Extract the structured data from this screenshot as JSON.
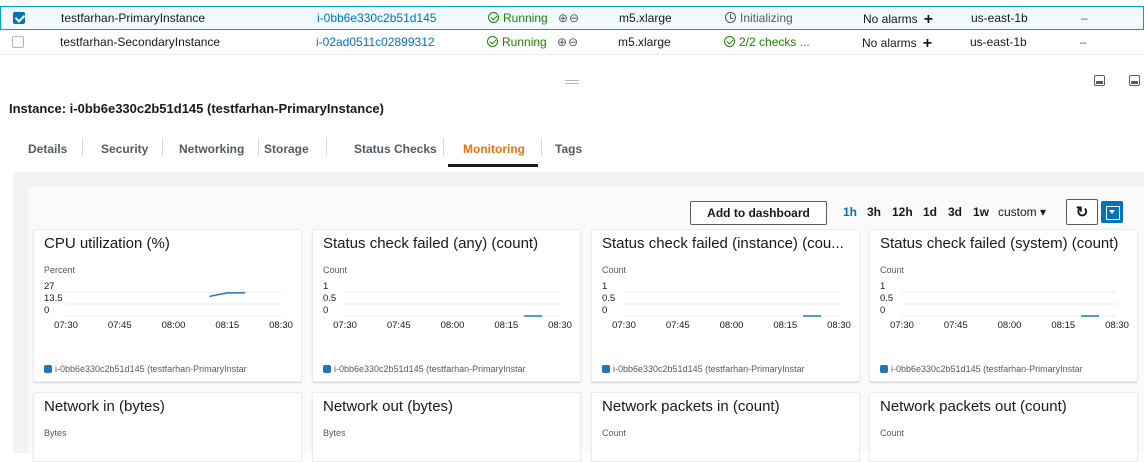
{
  "instances": [
    {
      "selected": true,
      "name": "testfarhan-PrimaryInstance",
      "id": "i-0bb6e330c2b51d145",
      "state": "Running",
      "type": "m5.xlarge",
      "status_check": "Initializing",
      "status_icon": "clock-icon",
      "alarms": "No alarms",
      "zone": "us-east-1b",
      "extra": "–"
    },
    {
      "selected": false,
      "name": "testfarhan-SecondaryInstance",
      "id": "i-02ad0511c02899312",
      "state": "Running",
      "type": "m5.xlarge",
      "status_check": "2/2 checks ...",
      "status_icon": "check-circle-icon",
      "alarms": "No alarms",
      "zone": "us-east-1b",
      "extra": "–"
    }
  ],
  "details": {
    "title": "Instance: i-0bb6e330c2b51d145 (testfarhan-PrimaryInstance)",
    "tabs": [
      "Details",
      "Security",
      "Networking",
      "Storage",
      "Status Checks",
      "Monitoring",
      "Tags"
    ],
    "active_tab": "Monitoring"
  },
  "toolbar": {
    "add_to_dashboard": "Add to dashboard",
    "ranges": [
      "1h",
      "3h",
      "12h",
      "1d",
      "3d",
      "1w"
    ],
    "active_range": "1h",
    "custom": "custom ▾",
    "refresh_icon": "refresh-icon"
  },
  "colors": {
    "accent": "#ec7211",
    "link": "#0073bb",
    "ok": "#1d8102",
    "series": "#1f77b4"
  },
  "chart_data": [
    {
      "type": "line",
      "title": "CPU utilization (%)",
      "ylabel": "Percent",
      "yticks": [
        "27",
        "13.5",
        "0"
      ],
      "ylim": [
        0,
        27
      ],
      "xticks": [
        "07:30",
        "07:45",
        "08:00",
        "08:15",
        "08:30"
      ],
      "x": [
        "08:10",
        "08:15",
        "08:20"
      ],
      "series": [
        {
          "name": "i-0bb6e330c2b51d145 (testfarhan-PrimaryInstar",
          "values": [
            22,
            26,
            26
          ]
        }
      ]
    },
    {
      "type": "line",
      "title": "Status check failed (any) (count)",
      "ylabel": "Count",
      "yticks": [
        "1",
        "0.5",
        "0"
      ],
      "ylim": [
        0,
        1
      ],
      "xticks": [
        "07:30",
        "07:45",
        "08:00",
        "08:15",
        "08:30"
      ],
      "x": [
        "08:20",
        "08:25"
      ],
      "series": [
        {
          "name": "i-0bb6e330c2b51d145 (testfarhan-PrimaryInstar",
          "values": [
            0,
            0
          ]
        }
      ]
    },
    {
      "type": "line",
      "title": "Status check failed (instance) (cou...",
      "ylabel": "Count",
      "yticks": [
        "1",
        "0.5",
        "0"
      ],
      "ylim": [
        0,
        1
      ],
      "xticks": [
        "07:30",
        "07:45",
        "08:00",
        "08:15",
        "08:30"
      ],
      "x": [
        "08:20",
        "08:25"
      ],
      "series": [
        {
          "name": "i-0bb6e330c2b51d145 (testfarhan-PrimaryInstar",
          "values": [
            0,
            0
          ]
        }
      ]
    },
    {
      "type": "line",
      "title": "Status check failed (system) (count)",
      "ylabel": "Count",
      "yticks": [
        "1",
        "0.5",
        "0"
      ],
      "ylim": [
        0,
        1
      ],
      "xticks": [
        "07:30",
        "07:45",
        "08:00",
        "08:15",
        "08:30"
      ],
      "x": [
        "08:20",
        "08:25"
      ],
      "series": [
        {
          "name": "i-0bb6e330c2b51d145 (testfarhan-PrimaryInstar",
          "values": [
            0,
            0
          ]
        }
      ]
    },
    {
      "type": "line",
      "title": "Network in (bytes)",
      "ylabel": "Bytes",
      "yticks": [],
      "xticks": [],
      "series": []
    },
    {
      "type": "line",
      "title": "Network out (bytes)",
      "ylabel": "Bytes",
      "yticks": [],
      "xticks": [],
      "series": []
    },
    {
      "type": "line",
      "title": "Network packets in (count)",
      "ylabel": "Count",
      "yticks": [],
      "xticks": [],
      "series": []
    },
    {
      "type": "line",
      "title": "Network packets out (count)",
      "ylabel": "Count",
      "yticks": [],
      "xticks": [],
      "series": []
    }
  ]
}
